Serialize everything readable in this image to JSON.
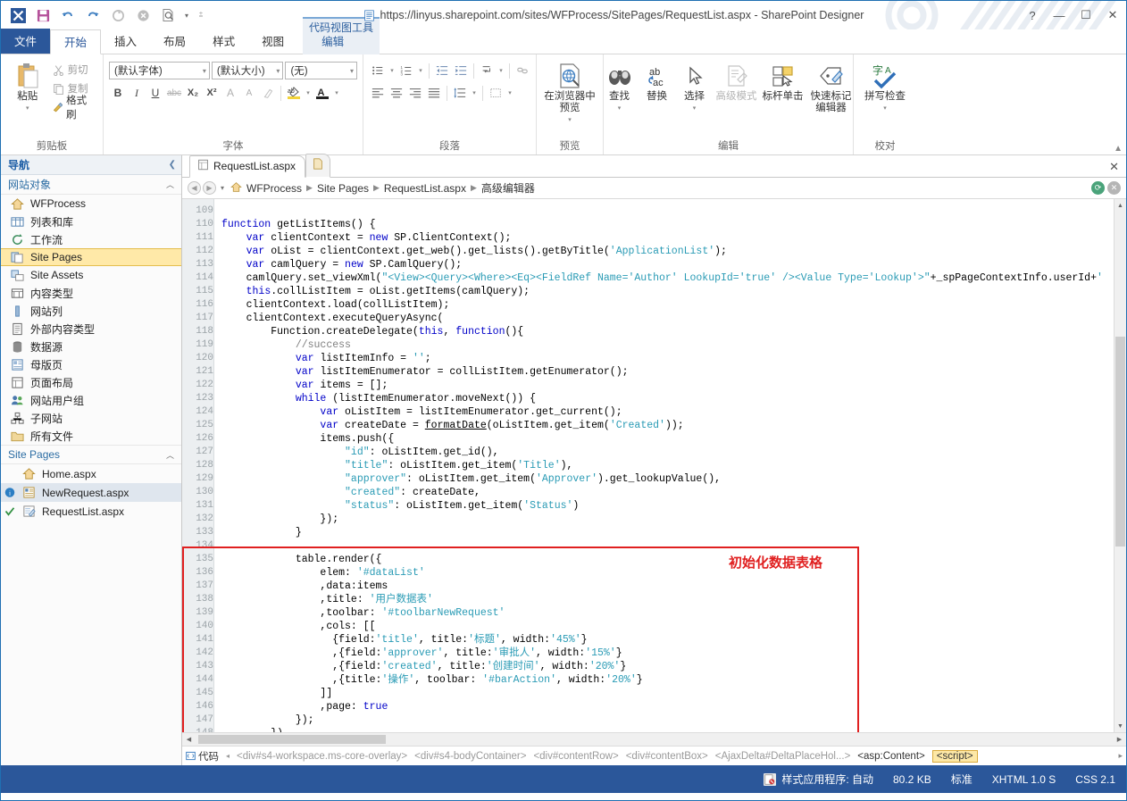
{
  "window": {
    "title": "https://linyus.sharepoint.com/sites/WFProcess/SitePages/RequestList.aspx - SharePoint Designer",
    "help_label": "?",
    "minimize_label": "—",
    "maximize_label": "☐",
    "close_label": "✕"
  },
  "quick_access": {
    "app_icon": "sharepoint-designer-icon",
    "save": "save-icon",
    "undo": "undo-icon",
    "redo": "redo-icon",
    "refresh": "refresh-icon",
    "stop": "stop-icon",
    "preview": "preview-icon",
    "customize": "customize-icon"
  },
  "ribbon": {
    "context_tab_title": "代码视图工具",
    "tabs": [
      {
        "label": "文件",
        "type": "file"
      },
      {
        "label": "开始",
        "type": "active"
      },
      {
        "label": "插入",
        "type": "normal"
      },
      {
        "label": "布局",
        "type": "normal"
      },
      {
        "label": "样式",
        "type": "normal"
      },
      {
        "label": "视图",
        "type": "normal"
      },
      {
        "label": "编辑",
        "type": "context"
      }
    ],
    "groups": {
      "clipboard": {
        "name": "剪贴板",
        "paste": "粘贴",
        "cut": "剪切",
        "copy": "复制",
        "format_painter": "格式刷"
      },
      "font": {
        "name": "字体",
        "font_family": "(默认字体)",
        "font_size": "(默认大小)",
        "font_style": "(无)",
        "bold": "B",
        "italic": "I",
        "underline": "U",
        "strike": "abc",
        "subscript": "X₂",
        "superscript": "X²",
        "grow": "A",
        "shrink": "A",
        "clear_format": "clear-format-icon",
        "highlight": "ab",
        "font_color": "A"
      },
      "paragraph": {
        "name": "段落",
        "bullets": "bullet-list-icon",
        "numbering": "numbered-list-icon",
        "outdent": "outdent-icon",
        "indent": "indent-icon",
        "line_break": "line-break-icon",
        "link": "link-icon",
        "align_left": "align-left-icon",
        "align_center": "align-center-icon",
        "align_right": "align-right-icon",
        "align_justify": "align-justify-icon",
        "line_spacing": "line-spacing-icon",
        "borders": "borders-icon"
      },
      "preview": {
        "name": "预览",
        "browser_preview": "在浏览器中\n预览"
      },
      "editing": {
        "name": "编辑",
        "find": "查找",
        "replace": "替换",
        "select": "选择",
        "advanced_mode": "高级模式",
        "bar_click": "标杆单击",
        "quick_tag_editor": "快速标记\n编辑器"
      },
      "proofing": {
        "name": "校对",
        "spell_check": "拼写检查",
        "spell_icon": "字A"
      }
    }
  },
  "nav": {
    "header": "导航",
    "collapse_icon": "chevron-left-icon",
    "sections": [
      {
        "label": "网站对象",
        "items": [
          {
            "label": "WFProcess",
            "icon": "home-icon",
            "state": "normal"
          },
          {
            "label": "列表和库",
            "icon": "lists-icon",
            "state": "normal"
          },
          {
            "label": "工作流",
            "icon": "workflow-icon",
            "state": "normal"
          },
          {
            "label": "Site Pages",
            "icon": "page-icon",
            "state": "selected"
          },
          {
            "label": "Site Assets",
            "icon": "assets-icon",
            "state": "normal"
          },
          {
            "label": "内容类型",
            "icon": "content-type-icon",
            "state": "normal"
          },
          {
            "label": "网站列",
            "icon": "column-icon",
            "state": "normal"
          },
          {
            "label": "外部内容类型",
            "icon": "external-content-icon",
            "state": "normal"
          },
          {
            "label": "数据源",
            "icon": "datasource-icon",
            "state": "normal"
          },
          {
            "label": "母版页",
            "icon": "masterpage-icon",
            "state": "normal"
          },
          {
            "label": "页面布局",
            "icon": "pagelayout-icon",
            "state": "normal"
          },
          {
            "label": "网站用户组",
            "icon": "users-icon",
            "state": "normal"
          },
          {
            "label": "子网站",
            "icon": "subsite-icon",
            "state": "normal"
          },
          {
            "label": "所有文件",
            "icon": "folder-icon",
            "state": "normal"
          }
        ]
      },
      {
        "label": "Site Pages",
        "items": [
          {
            "label": "Home.aspx",
            "icon": "home-page-icon",
            "state": "normal",
            "marker": ""
          },
          {
            "label": "NewRequest.aspx",
            "icon": "aspx-icon",
            "state": "selected2",
            "marker": "info-icon"
          },
          {
            "label": "RequestList.aspx",
            "icon": "aspx-edit-icon",
            "state": "normal",
            "marker": "check-icon"
          }
        ]
      }
    ]
  },
  "editor": {
    "doc_tab": "RequestList.aspx",
    "doc_tab_icon": "page-icon",
    "new_tab_icon": "new-page-icon",
    "close_label": "✕",
    "breadcrumb": [
      "WFProcess",
      "Site Pages",
      "RequestList.aspx",
      "高级编辑器"
    ],
    "breadcrumb_back": "◀",
    "breadcrumb_forward": "▶",
    "breadcrumb_dropdown": "▾",
    "refresh_button": "refresh-icon",
    "close_button": "close-icon",
    "annotation": "初始化数据表格",
    "first_line_number": 109,
    "lines": [
      {
        "n": 109,
        "t": ""
      },
      {
        "n": 110,
        "t": "function getListItems() {"
      },
      {
        "n": 111,
        "t": "    var clientContext = new SP.ClientContext();"
      },
      {
        "n": 112,
        "t": "    var oList = clientContext.get_web().get_lists().getByTitle('ApplicationList');"
      },
      {
        "n": 113,
        "t": "    var camlQuery = new SP.CamlQuery();"
      },
      {
        "n": 114,
        "t": "    camlQuery.set_viewXml(\"<View><Query><Where><Eq><FieldRef Name='Author' LookupId='true' /><Value Type='Lookup'>\"+_spPageContextInfo.userId+'"
      },
      {
        "n": 115,
        "t": "    this.collListItem = oList.getItems(camlQuery);"
      },
      {
        "n": 116,
        "t": "    clientContext.load(collListItem);"
      },
      {
        "n": 117,
        "t": "    clientContext.executeQueryAsync("
      },
      {
        "n": 118,
        "t": "        Function.createDelegate(this, function(){"
      },
      {
        "n": 119,
        "t": "            //success"
      },
      {
        "n": 120,
        "t": "            var listItemInfo = '';"
      },
      {
        "n": 121,
        "t": "            var listItemEnumerator = collListItem.getEnumerator();"
      },
      {
        "n": 122,
        "t": "            var items = [];"
      },
      {
        "n": 123,
        "t": "            while (listItemEnumerator.moveNext()) {"
      },
      {
        "n": 124,
        "t": "                var oListItem = listItemEnumerator.get_current();"
      },
      {
        "n": 125,
        "t": "                var createDate = formatDate(oListItem.get_item('Created'));"
      },
      {
        "n": 126,
        "t": "                items.push({"
      },
      {
        "n": 127,
        "t": "                    \"id\": oListItem.get_id(),"
      },
      {
        "n": 128,
        "t": "                    \"title\": oListItem.get_item('Title'),"
      },
      {
        "n": 129,
        "t": "                    \"approver\": oListItem.get_item('Approver').get_lookupValue(),"
      },
      {
        "n": 130,
        "t": "                    \"created\": createDate,"
      },
      {
        "n": 131,
        "t": "                    \"status\": oListItem.get_item('Status')"
      },
      {
        "n": 132,
        "t": "                });"
      },
      {
        "n": 133,
        "t": "            }"
      },
      {
        "n": 134,
        "t": ""
      },
      {
        "n": 135,
        "t": "            table.render({"
      },
      {
        "n": 136,
        "t": "                elem: '#dataList'"
      },
      {
        "n": 137,
        "t": "                ,data:items"
      },
      {
        "n": 138,
        "t": "                ,title: '用户数据表'"
      },
      {
        "n": 139,
        "t": "                ,toolbar: '#toolbarNewRequest'"
      },
      {
        "n": 140,
        "t": "                ,cols: [["
      },
      {
        "n": 141,
        "t": "                  {field:'title', title:'标题', width:'45%'}"
      },
      {
        "n": 142,
        "t": "                  ,{field:'approver', title:'审批人', width:'15%'}"
      },
      {
        "n": 143,
        "t": "                  ,{field:'created', title:'创建时间', width:'20%'}"
      },
      {
        "n": 144,
        "t": "                  ,{title:'操作', toolbar: '#barAction', width:'20%'}"
      },
      {
        "n": 145,
        "t": "                ]]"
      },
      {
        "n": 146,
        "t": "                ,page: true"
      },
      {
        "n": 147,
        "t": "            });"
      },
      {
        "n": 148,
        "t": "        }),"
      }
    ]
  },
  "tagbar": {
    "code_label": "代码",
    "back_arrow": "◂",
    "forward_arrow": "▸",
    "tags": [
      {
        "text": "<div#s4-workspace.ms-core-overlay>",
        "state": "dim"
      },
      {
        "text": "<div#s4-bodyContainer>",
        "state": "dim"
      },
      {
        "text": "<div#contentRow>",
        "state": "dim"
      },
      {
        "text": "<div#contentBox>",
        "state": "dim"
      },
      {
        "text": "<AjaxDelta#DeltaPlaceHol...>",
        "state": "dim"
      },
      {
        "text": "<asp:Content>",
        "state": "dark"
      },
      {
        "text": "<script>",
        "state": "selected"
      }
    ]
  },
  "statusbar": {
    "style_icon": "style-app-icon",
    "style_application": "样式应用程序: 自动",
    "size": "80.2 KB",
    "standard": "标准",
    "doctype": "XHTML 1.0 S",
    "css": "CSS 2.1"
  }
}
